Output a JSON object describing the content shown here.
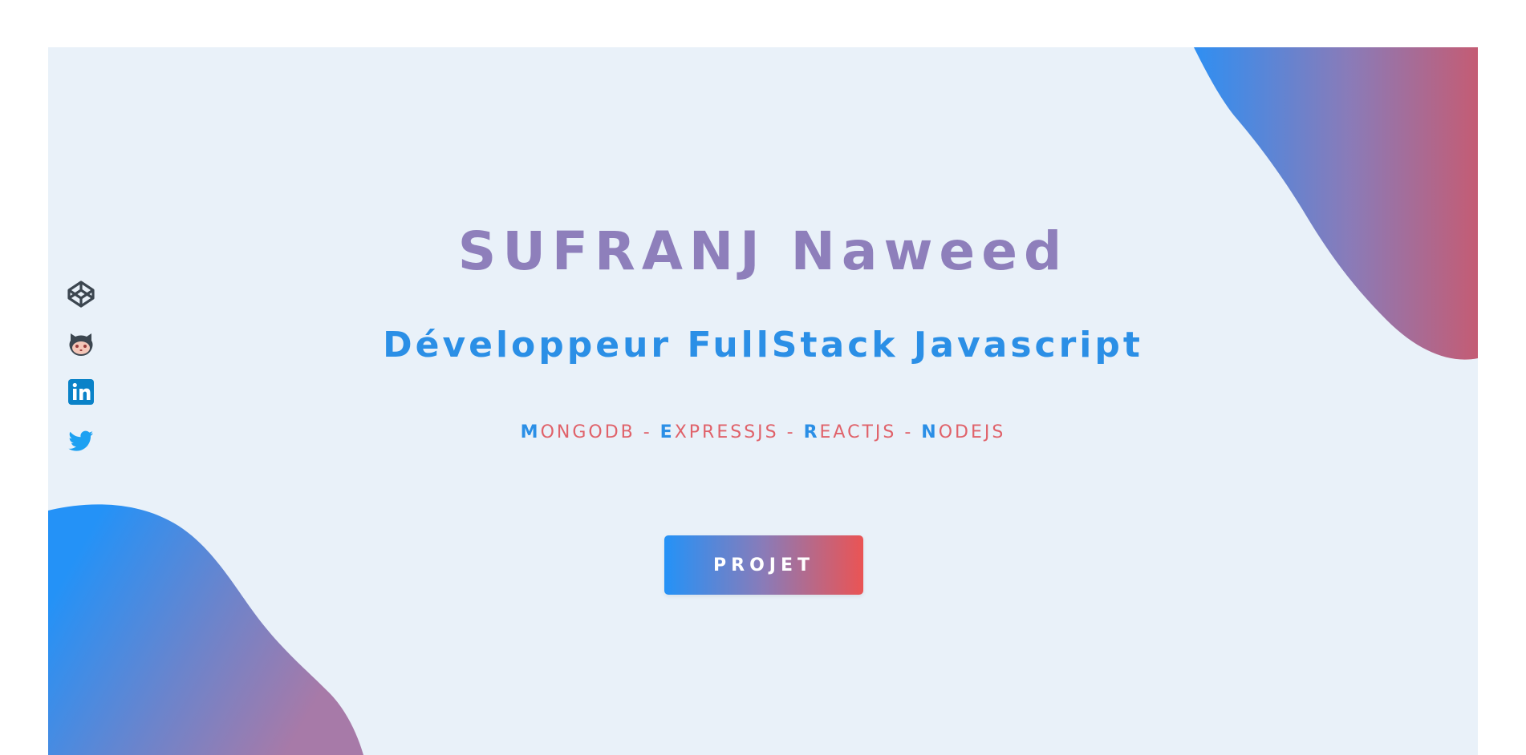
{
  "hero": {
    "name": "SUFRANJ Naweed",
    "role": "Développeur FullStack Javascript",
    "stack": [
      {
        "initial": "M",
        "rest": "ONGODB"
      },
      {
        "initial": "E",
        "rest": "XPRESSJS"
      },
      {
        "initial": "R",
        "rest": "EACTJS"
      },
      {
        "initial": "N",
        "rest": "ODEJS"
      }
    ],
    "stack_separator": " - ",
    "cta_label": "PROJET"
  },
  "social": [
    {
      "name": "codepen",
      "icon": "codepen-icon",
      "color": "#3c4650"
    },
    {
      "name": "github",
      "icon": "github-octocat-icon",
      "color": "#3c4650"
    },
    {
      "name": "linkedin",
      "icon": "linkedin-icon",
      "color": "#0a82c8"
    },
    {
      "name": "twitter",
      "icon": "twitter-icon",
      "color": "#1da1f2"
    }
  ],
  "colors": {
    "background": "#e9f1f9",
    "name": "#8e7fbb",
    "accent_blue": "#2b8fe6",
    "accent_red": "#e0626a",
    "gradient_start": "#2492f7",
    "gradient_end": "#ea5454"
  }
}
